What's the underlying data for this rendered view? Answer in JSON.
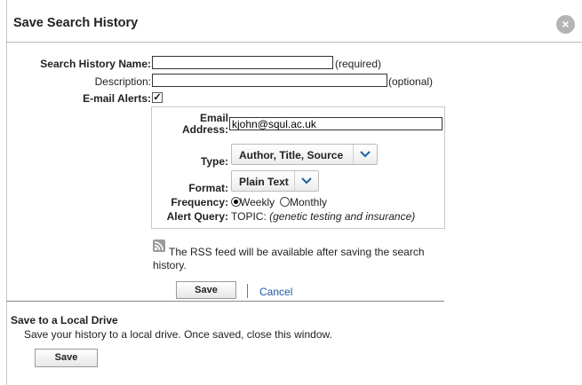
{
  "dialog": {
    "title": "Save Search History",
    "close_icon": "×"
  },
  "form": {
    "name_label": "Search History Name:",
    "name_value": "",
    "name_hint": "(required)",
    "description_label": "Description:",
    "description_value": "",
    "description_hint": "(optional)",
    "alerts_label": "E-mail Alerts:",
    "alerts_checked": "✓"
  },
  "alert_settings": {
    "email_label_line1": "Email",
    "email_label_line2": "Address:",
    "email_value": "kjohn@squl.ac.uk",
    "type_label": "Type:",
    "type_value": "Author, Title, Source",
    "format_label": "Format:",
    "format_value": "Plain Text",
    "frequency_label": "Frequency:",
    "frequency_options": [
      "Weekly",
      "Monthly"
    ],
    "frequency_selected": "Weekly",
    "query_label": "Alert Query:",
    "query_prefix": "TOPIC:",
    "query_value": "(genetic testing and insurance)"
  },
  "rss": {
    "icon": "rss-icon",
    "text_line1": "The RSS feed will be available after saving the search",
    "text_line2": "history."
  },
  "actions": {
    "save_label": "Save",
    "separator": "|",
    "cancel_label": "Cancel"
  },
  "local_drive": {
    "heading": "Save to a Local Drive",
    "description": "Save your history to a local drive. Once saved, close this window.",
    "save_label": "Save"
  },
  "colors": {
    "link": "#1a5aa8",
    "close_button": "#b4b4b4"
  }
}
